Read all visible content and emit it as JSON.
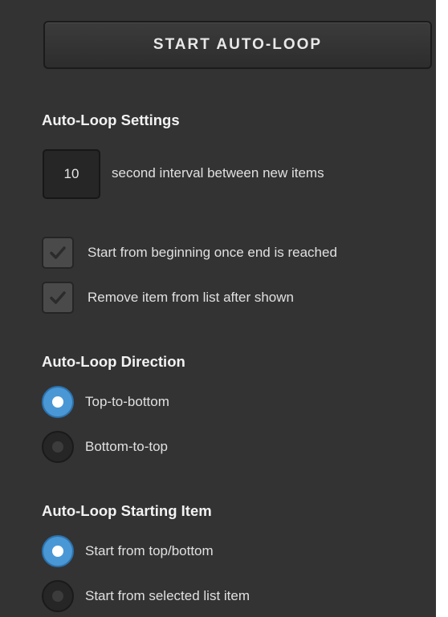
{
  "start_button": {
    "label": "START AUTO-LOOP"
  },
  "settings": {
    "heading": "Auto-Loop Settings",
    "interval": {
      "value": "10",
      "label": "second interval between new items"
    },
    "options": [
      {
        "label": "Start from beginning once end is reached",
        "checked": true
      },
      {
        "label": "Remove item from list after shown",
        "checked": true
      }
    ]
  },
  "direction": {
    "heading": "Auto-Loop Direction",
    "options": [
      {
        "label": "Top-to-bottom",
        "selected": true
      },
      {
        "label": "Bottom-to-top",
        "selected": false
      }
    ]
  },
  "starting_item": {
    "heading": "Auto-Loop Starting Item",
    "options": [
      {
        "label": "Start from top/bottom",
        "selected": true
      },
      {
        "label": "Start from selected list item",
        "selected": false
      }
    ]
  },
  "colors": {
    "panel_background": "#333333",
    "radio_selected": "#4a97d6",
    "text": "#e0e0e0"
  },
  "icons": {
    "checkbox_check": "check-icon"
  }
}
